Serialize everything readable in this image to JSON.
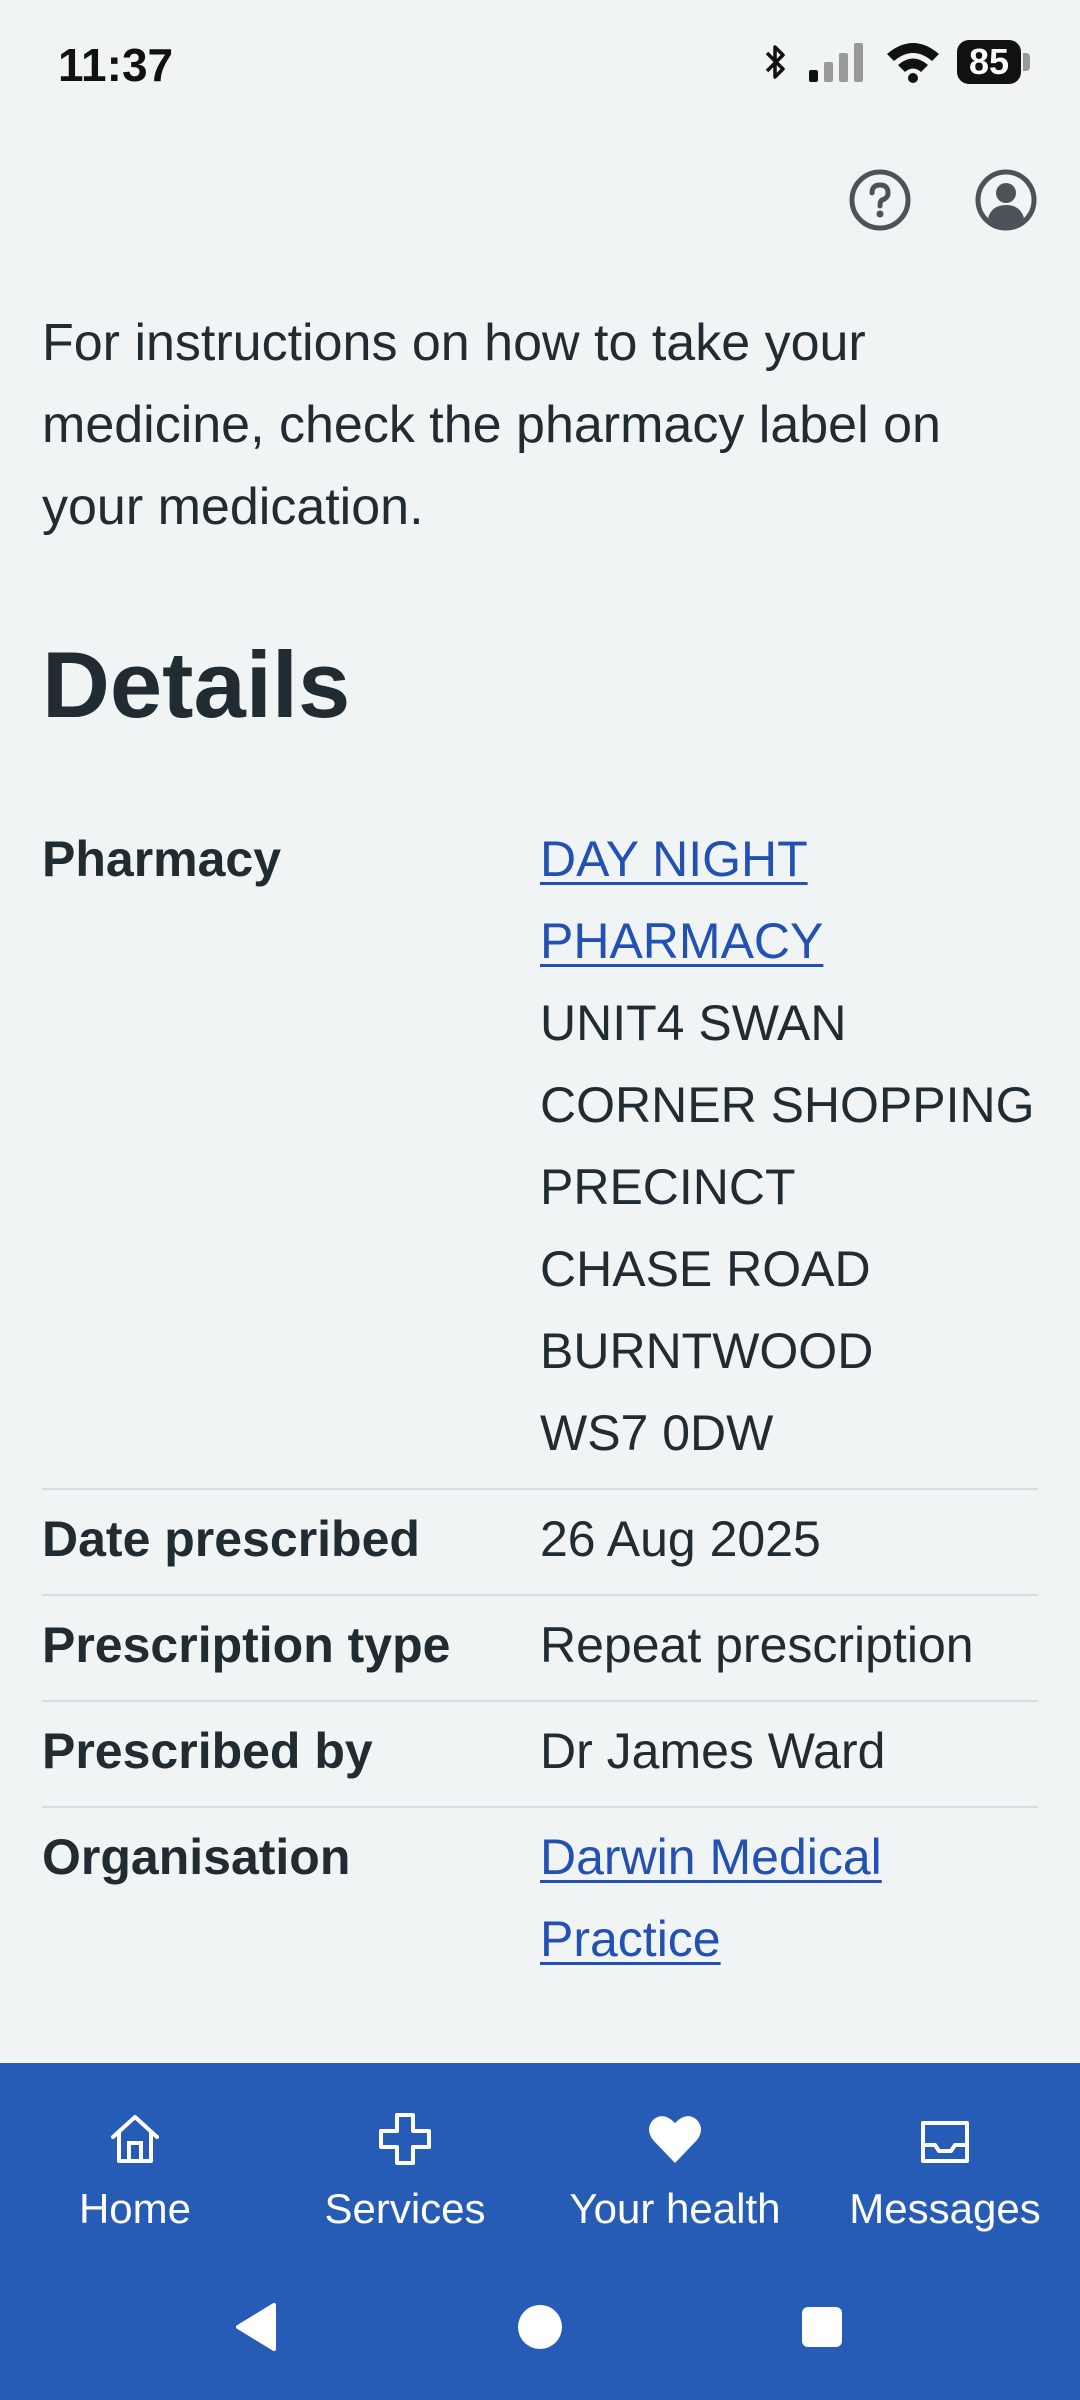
{
  "status_bar": {
    "time": "11:37",
    "battery_level": "85",
    "icons": [
      "bluetooth-icon",
      "signal-icon",
      "wifi-icon",
      "battery-icon"
    ]
  },
  "header": {
    "icons": [
      "help-icon",
      "account-icon"
    ]
  },
  "intro_text": "For instructions on how to take your medicine, check the pharmacy label on your medication.",
  "details": {
    "title": "Details",
    "pharmacy": {
      "label": "Pharmacy",
      "name_line1": "DAY NIGHT",
      "name_line2": "PHARMACY",
      "address": [
        "UNIT4 SWAN",
        "CORNER SHOPPING",
        "PRECINCT",
        "CHASE ROAD",
        "BURNTWOOD",
        "WS7 0DW"
      ]
    },
    "date_prescribed": {
      "label": "Date prescribed",
      "value": "26 Aug 2025"
    },
    "prescription_type": {
      "label": "Prescription type",
      "value": "Repeat prescription"
    },
    "prescribed_by": {
      "label": "Prescribed by",
      "value": "Dr James Ward"
    },
    "organisation": {
      "label": "Organisation",
      "value_line1": "Darwin Medical",
      "value_line2": "Practice"
    }
  },
  "bottom_nav": {
    "items": [
      {
        "label": "Home",
        "icon": "home-icon"
      },
      {
        "label": "Services",
        "icon": "plus-icon"
      },
      {
        "label": "Your health",
        "icon": "heart-icon"
      },
      {
        "label": "Messages",
        "icon": "inbox-icon"
      }
    ]
  },
  "colors": {
    "background": "#f0f4f5",
    "text": "#212b32",
    "link": "#2350b3",
    "nav_background": "#265cb6",
    "divider": "#d8dde0"
  }
}
